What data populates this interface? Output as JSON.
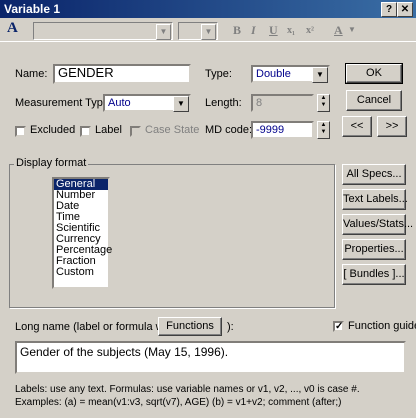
{
  "window": {
    "title": "Variable 1",
    "help_btn": "?",
    "close_btn": "✕"
  },
  "toolbar": {
    "font_icon": "A",
    "bold": "B",
    "italic": "I",
    "underline": "U",
    "subscript": "x₁",
    "superscript": "x²",
    "color": "A"
  },
  "fields": {
    "name_label": "Name:",
    "name_value": "GENDER",
    "type_label": "Type:",
    "type_value": "Double",
    "measurement_label": "Measurement Type:",
    "measurement_value": "Auto",
    "length_label": "Length:",
    "length_value": "8",
    "excluded_label": "Excluded",
    "label_label": "Label",
    "casestate_label": "Case State",
    "mdcode_label": "MD code:",
    "mdcode_value": "-9999"
  },
  "buttons": {
    "ok": "OK",
    "cancel": "Cancel",
    "prev": "<<",
    "next": ">>",
    "all_specs": "All Specs...",
    "text_labels": "Text Labels...",
    "values_stats": "Values/Stats...",
    "properties": "Properties...",
    "bundles": "[ Bundles ]...",
    "functions": "Functions"
  },
  "display_format": {
    "title": "Display format",
    "items": [
      "General",
      "Number",
      "Date",
      "Time",
      "Scientific",
      "Currency",
      "Percentage",
      "Fraction",
      "Custom"
    ],
    "selected": "General"
  },
  "long_name": {
    "label_prefix": "Long name (label or formula with",
    "label_suffix": "):",
    "function_guide_label": "Function guide",
    "value": "Gender of the subjects (May 15, 1996)."
  },
  "help": {
    "line1": "Labels: use any text.  Formulas: use variable names or v1, v2, ..., v0 is case #.",
    "line2": "Examples:  (a) = mean(v1:v3, sqrt(v7), AGE)  (b) = v1+v2; comment (after;)"
  }
}
